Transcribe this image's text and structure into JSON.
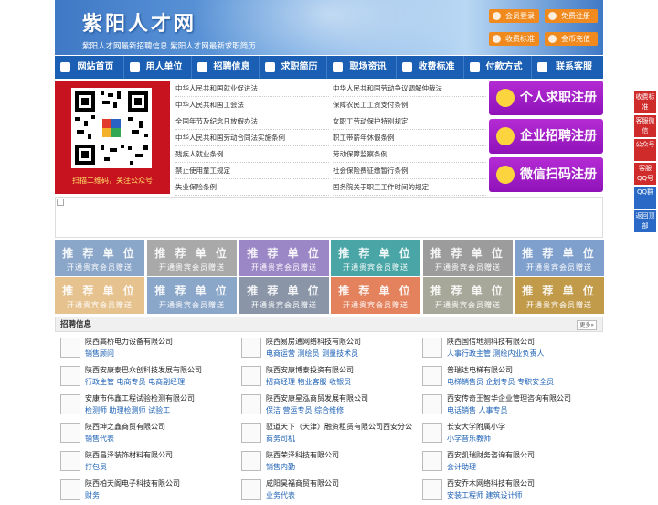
{
  "header": {
    "title": "紫阳人才网",
    "tagline": "紫阳人才网最新招聘信息   紫阳人才网最新求职简历",
    "buttons": [
      {
        "label": "会员登录",
        "icon": "user-icon"
      },
      {
        "label": "免费注册",
        "icon": "user-add-icon"
      },
      {
        "label": "收费标准",
        "icon": "yen-icon"
      },
      {
        "label": "金币充值",
        "icon": "coin-icon"
      }
    ]
  },
  "nav": {
    "items": [
      {
        "label": "网站首页",
        "icon": "home-icon"
      },
      {
        "label": "用人单位",
        "icon": "building-icon"
      },
      {
        "label": "招聘信息",
        "icon": "megaphone-icon"
      },
      {
        "label": "求职简历",
        "icon": "resume-icon"
      },
      {
        "label": "职场资讯",
        "icon": "news-icon"
      },
      {
        "label": "收费标准",
        "icon": "yen-icon"
      },
      {
        "label": "付款方式",
        "icon": "card-icon"
      },
      {
        "label": "联系客服",
        "icon": "phone-icon"
      }
    ]
  },
  "qr": {
    "caption": "扫描二维码，关注公众号"
  },
  "laws": {
    "left": [
      "中华人民共和国就业促进法",
      "中华人民共和国工会法",
      "全国年节及纪念日放假办法",
      "中华人民共和国劳动合同法实施条例",
      "残疾人就业条例",
      "禁止使用童工规定",
      "失业保险条例"
    ],
    "right": [
      "中华人民共和国劳动争议调解仲裁法",
      "保障农民工工资支付条例",
      "女职工劳动保护特别规定",
      "职工带薪年休假条例",
      "劳动保障监察条例",
      "社会保险费征缴暂行条例",
      "国务院关于职工工作时间的规定"
    ]
  },
  "register": [
    {
      "label": "个人求职注册",
      "icon": "person-icon"
    },
    {
      "label": "企业招聘注册",
      "icon": "company-icon"
    },
    {
      "label": "微信扫码注册",
      "icon": "wechat-icon"
    }
  ],
  "recommend": {
    "title": "推 荐 单 位",
    "subtitle": "开通贵宾会员赠送",
    "colors": [
      "#8aa6c9",
      "#a9a9a9",
      "#9b86c6",
      "#4aa6a6",
      "#9c9c9c",
      "#7fa0cc",
      "#e6c28f",
      "#8aa6c9",
      "#8a96a8",
      "#e4825e",
      "#a8a89a",
      "#c19a4a"
    ]
  },
  "jobs": {
    "header": "招聘信息",
    "more": "更多»",
    "columns": [
      [
        {
          "company": "陕西高桥电力设备有限公司",
          "positions": "销售顾问"
        },
        {
          "company": "陕西安康泰巴众创科技发展有限公司",
          "positions": "行政主管 电商专员 电商副经理"
        },
        {
          "company": "安康市伟鑫工程试验检测有限公司",
          "positions": "检测师 助理检测师 试验工"
        },
        {
          "company": "陕西坤之鑫商贸有限公司",
          "positions": "销售代表"
        },
        {
          "company": "陕西昌泽装饰材料有限公司",
          "positions": "打包员"
        },
        {
          "company": "陕西柏天阁电子科技有限公司",
          "positions": "财务"
        }
      ],
      [
        {
          "company": "陕西易房通网络科技有限公司",
          "positions": "电商运营 测绘员 测量技术员"
        },
        {
          "company": "陕西安康博泰投资有限公司",
          "positions": "招商经理 物业客服 收银员"
        },
        {
          "company": "陕西安康星泓商贸发展有限公司",
          "positions": "保洁 营运专员 综合维修"
        },
        {
          "company": "驭道天下（天津）融资租赁有限公司西安分公",
          "positions": "商务司机"
        },
        {
          "company": "陕西荣泽科技有限公司",
          "positions": "销售内勤"
        },
        {
          "company": "咸阳昊福商贸有限公司",
          "positions": "业务代表"
        }
      ],
      [
        {
          "company": "陕西国信地测科技有限公司",
          "positions": "人事行政主管 测绘内业负责人"
        },
        {
          "company": "普瑞达电梯有限公司",
          "positions": "电梯销售员 企划专员 专职安全员"
        },
        {
          "company": "西安传奇王智华企业管理咨询有限公司",
          "positions": "电话销售 人事专员"
        },
        {
          "company": "长安大学附属小学",
          "positions": "小学音乐教师"
        },
        {
          "company": "西安凯瑞财务咨询有限公司",
          "positions": "会计助理"
        },
        {
          "company": "西安乔木网络科技有限公司",
          "positions": "安装工程师 建筑设计师"
        }
      ]
    ]
  },
  "sidebar": [
    "收费标准",
    "客服微信",
    "公众号",
    "客服QQ号",
    "QQ群",
    "返回顶部"
  ]
}
